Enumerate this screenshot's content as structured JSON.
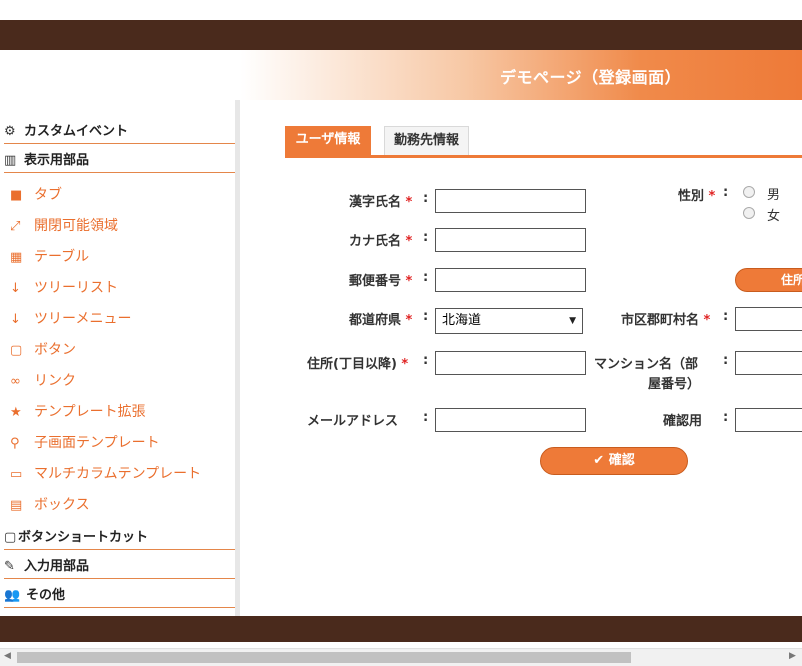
{
  "header": {
    "title": "デモページ（登録画面）"
  },
  "sidebar": {
    "sections": [
      {
        "icon": "gears-icon",
        "glyph": "⚙",
        "label": "カスタムイベント"
      },
      {
        "icon": "bar-chart-icon",
        "glyph": "▥",
        "label": "表示用部品"
      },
      {
        "icon": "square-icon",
        "glyph": "▢",
        "label": "ボタンショートカット"
      },
      {
        "icon": "edit-icon",
        "glyph": "✎",
        "label": "入力用部品"
      },
      {
        "icon": "users-icon",
        "glyph": "👥",
        "label": "その他"
      }
    ],
    "items": [
      {
        "icon": "folder-icon",
        "glyph": "■",
        "label": "タブ"
      },
      {
        "icon": "expand-icon",
        "glyph": "⤢",
        "label": "開閉可能領域"
      },
      {
        "icon": "table-icon",
        "glyph": "▦",
        "label": "テーブル"
      },
      {
        "icon": "sort-icon",
        "glyph": "↓",
        "label": "ツリーリスト"
      },
      {
        "icon": "sort-icon",
        "glyph": "↓",
        "label": "ツリーメニュー"
      },
      {
        "icon": "square-outline-icon",
        "glyph": "▢",
        "label": "ボタン"
      },
      {
        "icon": "link-icon",
        "glyph": "∞",
        "label": "リンク"
      },
      {
        "icon": "star-icon",
        "glyph": "★",
        "label": "テンプレート拡張"
      },
      {
        "icon": "search-icon",
        "glyph": "⚲",
        "label": "子画面テンプレート"
      },
      {
        "icon": "monitor-icon",
        "glyph": "▭",
        "label": "マルチカラムテンプレート"
      },
      {
        "icon": "file-icon",
        "glyph": "▤",
        "label": "ボックス"
      }
    ]
  },
  "tabs": [
    {
      "label": "ユーザ情報",
      "active": true
    },
    {
      "label": "勤務先情報",
      "active": false
    }
  ],
  "form": {
    "kanji_name": {
      "label": "漢字氏名",
      "required_mark": "*",
      "value": ""
    },
    "kana_name": {
      "label": "カナ氏名",
      "required_mark": "*",
      "value": ""
    },
    "postal_code": {
      "label": "郵便番号",
      "required_mark": "*",
      "value": ""
    },
    "prefecture": {
      "label": "都道府県",
      "required_mark": "*",
      "selected": "北海道"
    },
    "address": {
      "label": "住所(丁目以降)",
      "required_mark": "*",
      "value": ""
    },
    "email": {
      "label": "メールアドレス",
      "value": ""
    },
    "gender": {
      "label": "性別",
      "required_mark": "*",
      "options": [
        "男",
        "女"
      ]
    },
    "address_search_button": "住所",
    "city": {
      "label": "市区郡町村名",
      "required_mark": "*",
      "value": ""
    },
    "mansion": {
      "label_line1": "マンション名（部",
      "label_line2": "屋番号）",
      "value": ""
    },
    "email_confirm": {
      "label": "確認用",
      "value": ""
    },
    "colon": ":"
  },
  "confirm_button": {
    "icon": "check-icon",
    "glyph": "✔",
    "label": "確認"
  },
  "colors": {
    "accent": "#ee7a38",
    "dark": "#4a2a1c",
    "required": "#e02424"
  }
}
